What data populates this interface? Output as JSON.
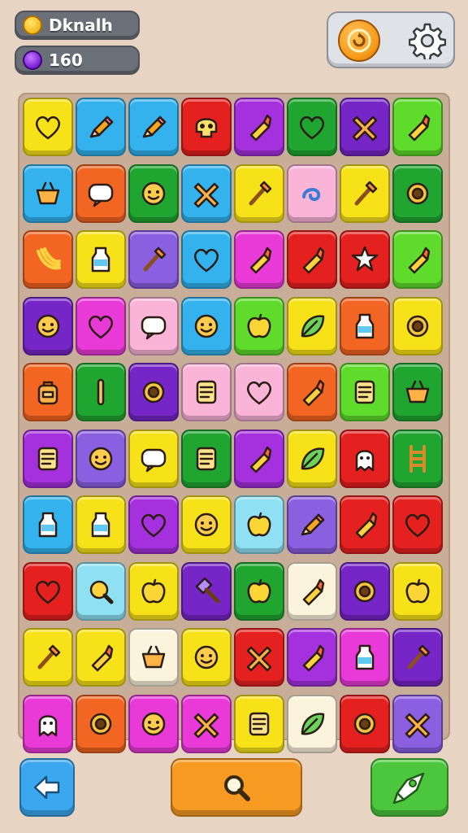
{
  "hud": {
    "player_name": "Dknalh",
    "gem_count": "160"
  },
  "top_buttons": [
    "reward-coin",
    "settings-gear"
  ],
  "colors": {
    "background": "#e8d4c2",
    "board": "#c8ae99",
    "palette": {
      "Y": "#f7e21a",
      "B": "#33b2ee",
      "R": "#e4211f",
      "P": "#a531de",
      "G": "#21a531",
      "V": "#7625c6",
      "L": "#5fdb2c",
      "O": "#f26522",
      "K": "#f9b4d8",
      "M": "#e93ad8",
      "C": "#8fe0f2",
      "W": "#fbf3dc",
      "N": "#8a5fe0",
      "E": "#66cc33"
    }
  },
  "board": {
    "rows": 10,
    "cols": 8,
    "tiles": [
      [
        [
          "Y",
          "heart"
        ],
        [
          "B",
          "pencil"
        ],
        [
          "B",
          "pencil"
        ],
        [
          "R",
          "skull"
        ],
        [
          "P",
          "crayon"
        ],
        [
          "G",
          "heart"
        ],
        [
          "V",
          "cross"
        ],
        [
          "L",
          "crayon"
        ]
      ],
      [
        [
          "B",
          "basket"
        ],
        [
          "O",
          "bubble"
        ],
        [
          "G",
          "face"
        ],
        [
          "B",
          "cross"
        ],
        [
          "Y",
          "brush"
        ],
        [
          "K",
          "swirl"
        ],
        [
          "Y",
          "brush"
        ],
        [
          "G",
          "ring"
        ]
      ],
      [
        [
          "O",
          "banana"
        ],
        [
          "Y",
          "bottle"
        ],
        [
          "N",
          "brush"
        ],
        [
          "B",
          "heart"
        ],
        [
          "M",
          "crayon"
        ],
        [
          "R",
          "crayon"
        ],
        [
          "R",
          "star"
        ],
        [
          "L",
          "crayon"
        ]
      ],
      [
        [
          "V",
          "face"
        ],
        [
          "M",
          "heart"
        ],
        [
          "K",
          "bubble"
        ],
        [
          "B",
          "face"
        ],
        [
          "L",
          "apple"
        ],
        [
          "Y",
          "leaf"
        ],
        [
          "O",
          "bottle"
        ],
        [
          "Y",
          "ring"
        ]
      ],
      [
        [
          "O",
          "backpack"
        ],
        [
          "G",
          "stick"
        ],
        [
          "V",
          "ring"
        ],
        [
          "K",
          "note"
        ],
        [
          "K",
          "heart"
        ],
        [
          "O",
          "crayon"
        ],
        [
          "L",
          "note"
        ],
        [
          "G",
          "basket"
        ]
      ],
      [
        [
          "P",
          "note"
        ],
        [
          "N",
          "face"
        ],
        [
          "Y",
          "bubble"
        ],
        [
          "G",
          "note"
        ],
        [
          "P",
          "crayon"
        ],
        [
          "Y",
          "leaf"
        ],
        [
          "R",
          "ghost"
        ],
        [
          "G",
          "ladder"
        ]
      ],
      [
        [
          "B",
          "bottle"
        ],
        [
          "Y",
          "bottle"
        ],
        [
          "P",
          "heart"
        ],
        [
          "Y",
          "face"
        ],
        [
          "C",
          "apple"
        ],
        [
          "N",
          "pencil"
        ],
        [
          "R",
          "crayon"
        ],
        [
          "R",
          "heart"
        ]
      ],
      [
        [
          "R",
          "heart"
        ],
        [
          "C",
          "search"
        ],
        [
          "Y",
          "apple"
        ],
        [
          "V",
          "hammer"
        ],
        [
          "G",
          "apple"
        ],
        [
          "W",
          "crayon"
        ],
        [
          "V",
          "ring"
        ],
        [
          "Y",
          "apple"
        ]
      ],
      [
        [
          "Y",
          "brush"
        ],
        [
          "Y",
          "crayon"
        ],
        [
          "W",
          "basket"
        ],
        [
          "Y",
          "face"
        ],
        [
          "R",
          "cross"
        ],
        [
          "P",
          "crayon"
        ],
        [
          "M",
          "bottle"
        ],
        [
          "V",
          "brush"
        ]
      ],
      [
        [
          "M",
          "ghost"
        ],
        [
          "O",
          "ring"
        ],
        [
          "M",
          "face"
        ],
        [
          "M",
          "cross"
        ],
        [
          "Y",
          "note"
        ],
        [
          "W",
          "leaf"
        ],
        [
          "R",
          "ring"
        ],
        [
          "N",
          "cross"
        ]
      ]
    ]
  },
  "bottom_bar": [
    "back-arrow",
    "search",
    "rocket-boost"
  ]
}
